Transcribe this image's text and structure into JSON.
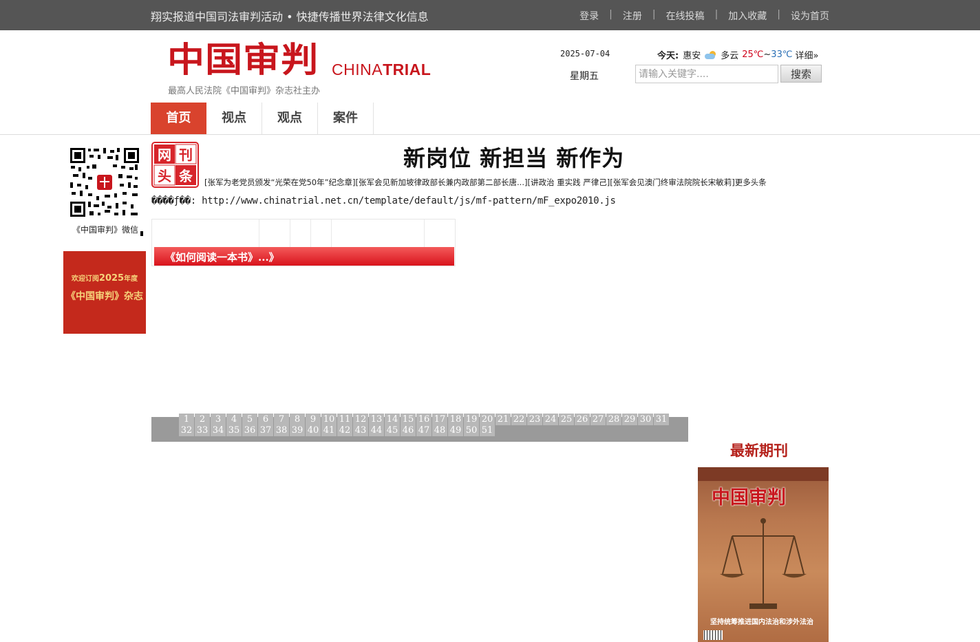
{
  "topbar": {
    "slogan": "翔实报道中国司法审判活动 • 快捷传播世界法律文化信息",
    "links": [
      "登录",
      "注册",
      "在线投稿",
      "加入收藏",
      "设为首页"
    ]
  },
  "header": {
    "logo_cn": "中国审判",
    "logo_en_light": "CHINA",
    "logo_en_bold": "TRIAL",
    "logo_sub": "最高人民法院《中国审判》杂志社主办",
    "date": "2025-07-04",
    "weekday": "星期五",
    "weather": {
      "today_label": "今天:",
      "city": "惠安",
      "condition": "多云",
      "high": "25℃",
      "tilde": "~",
      "low": "33℃",
      "detail": "详细»"
    },
    "search": {
      "placeholder": "请输入关键字....",
      "button": "搜索"
    }
  },
  "nav": {
    "tabs": [
      "首页",
      "视点",
      "观点",
      "案件"
    ]
  },
  "sidebar": {
    "qr_caption": "《中国审判》微信",
    "subscribe_l1_a": "欢迎订阅",
    "subscribe_l1_year": "2025",
    "subscribe_l1_b": "年度",
    "subscribe_l2": "《中国审判》杂志"
  },
  "headlines": {
    "badge_top": "网刊",
    "badge_bottom": "头条",
    "title": "新岗位 新担当 新作为",
    "links": [
      "[张军为老党员颁发“光荣在党50年”纪念章]",
      "[张军会见新加坡律政部长兼内政部第二部长唐...]",
      "[讲政治 重实践 严律己]",
      "[张军会见澳门终审法院院长宋敏莉]",
      "更多头条"
    ],
    "error_line": "����ƒ��: http://www.chinatrial.net.cn/template/default/js/mf-pattern/mF_expo2010.js"
  },
  "slideshow": {
    "caption": "《如何阅读一本书》...》"
  },
  "pager": {
    "row1": [
      "1",
      "2",
      "3",
      "4",
      "5",
      "6",
      "7",
      "8",
      "9",
      "10",
      "11",
      "12",
      "13",
      "14",
      "15",
      "16",
      "17",
      "18",
      "19",
      "20",
      "21",
      "22",
      "23",
      "24",
      "25",
      "26",
      "27",
      "28",
      "29",
      "30",
      "31"
    ],
    "row2": [
      "32",
      "33",
      "34",
      "35",
      "36",
      "37",
      "38",
      "39",
      "40",
      "41",
      "42",
      "43",
      "44",
      "45",
      "46",
      "47",
      "48",
      "49",
      "50",
      "51"
    ]
  },
  "latest": {
    "title": "最新期刊",
    "cover_title": "中国审判",
    "cover_headline": "坚持统筹推进国内法治和涉外法治"
  },
  "colors": {
    "brand_red": "#c8161d",
    "nav_active": "#d9432d",
    "topbar": "#555555"
  }
}
